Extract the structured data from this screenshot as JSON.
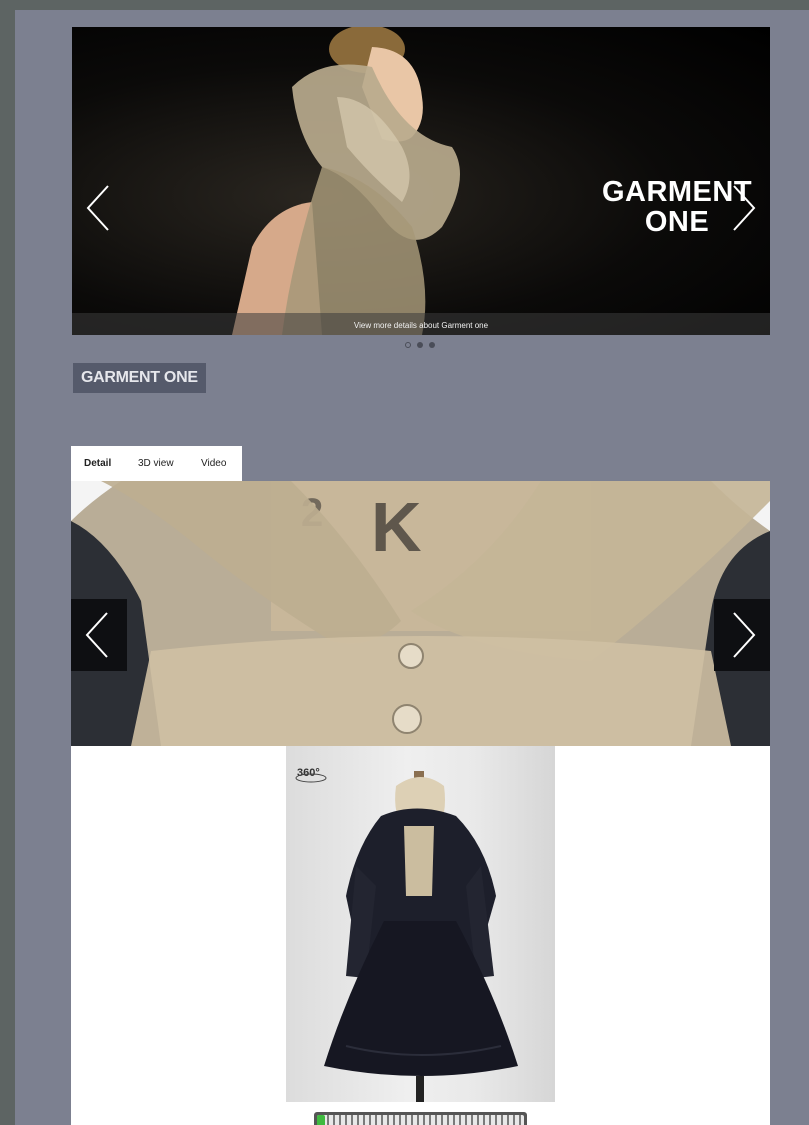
{
  "hero": {
    "title_line1": "GARMENT",
    "title_line2": "ONE",
    "caption": "View more details about Garment one",
    "prev_icon": "chevron-left-icon",
    "next_icon": "chevron-right-icon"
  },
  "carousel": {
    "dots": 3,
    "active_index": 0
  },
  "garment": {
    "label": "GARMENT ONE"
  },
  "tabs": [
    {
      "label": "Detail",
      "active": true
    },
    {
      "label": "3D view",
      "active": false
    },
    {
      "label": "Video",
      "active": false
    }
  ],
  "viewer": {
    "badge": "360°",
    "progress": 0.04
  },
  "colors": {
    "page_bg": "#7c8090",
    "label_bg": "#555a6b",
    "progress_fill": "#3fba3f"
  }
}
